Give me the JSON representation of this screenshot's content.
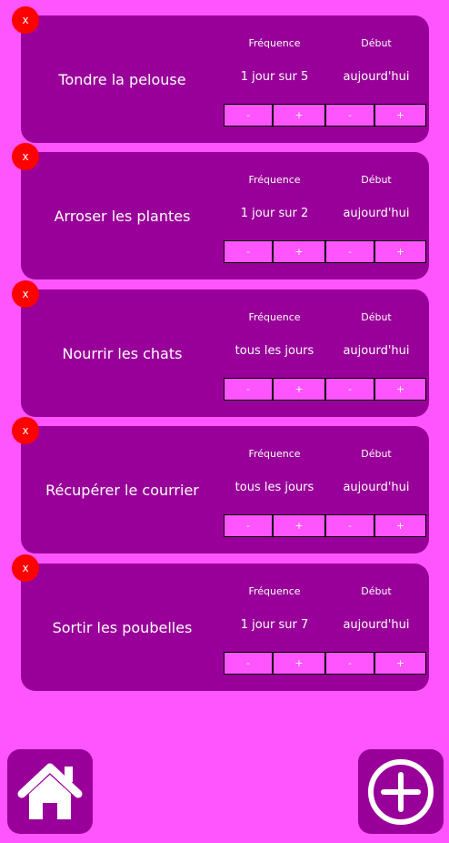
{
  "tasks": [
    {
      "name": "Tondre la pelouse",
      "frequency_label": "Fréquence",
      "frequency_value": "1 jour sur 5",
      "start_label": "Début",
      "start_value": "aujourd'hui",
      "delete_label": "x",
      "minus_label": "-",
      "plus_label": "+"
    },
    {
      "name": "Arroser les plantes",
      "frequency_label": "Fréquence",
      "frequency_value": "1 jour sur 2",
      "start_label": "Début",
      "start_value": "aujourd'hui",
      "delete_label": "x",
      "minus_label": "-",
      "plus_label": "+"
    },
    {
      "name": "Nourrir les chats",
      "frequency_label": "Fréquence",
      "frequency_value": "tous les jours",
      "start_label": "Début",
      "start_value": "aujourd'hui",
      "delete_label": "x",
      "minus_label": "-",
      "plus_label": "+"
    },
    {
      "name": "Récupérer le courrier",
      "frequency_label": "Fréquence",
      "frequency_value": "tous les jours",
      "start_label": "Début",
      "start_value": "aujourd'hui",
      "delete_label": "x",
      "minus_label": "-",
      "plus_label": "+"
    },
    {
      "name": "Sortir les poubelles",
      "frequency_label": "Fréquence",
      "frequency_value": "1 jour sur 7",
      "start_label": "Début",
      "start_value": "aujourd'hui",
      "delete_label": "x",
      "minus_label": "-",
      "plus_label": "+"
    }
  ],
  "nav": {
    "home_icon": "home-icon",
    "add_icon": "plus-circle-icon"
  },
  "colors": {
    "background": "#ff55ff",
    "card": "#990099",
    "delete": "#ff0000"
  }
}
